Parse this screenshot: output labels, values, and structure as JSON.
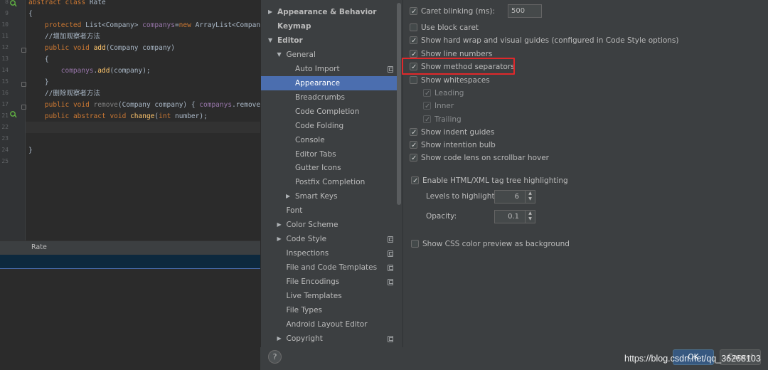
{
  "editor": {
    "lines": [
      {
        "num": "8",
        "code": "abstract class Rate"
      },
      {
        "num": "9",
        "code": "{"
      },
      {
        "num": "10",
        "code": "    protected List<Company> companys=new ArrayList<Company>();"
      },
      {
        "num": "11",
        "code": "    //增加观察者方法"
      },
      {
        "num": "12",
        "code": "    public void add(Company company)"
      },
      {
        "num": "13",
        "code": "    {"
      },
      {
        "num": "14",
        "code": "        companys.add(company);"
      },
      {
        "num": "15",
        "code": "    }"
      },
      {
        "num": "16",
        "code": "    //删除观察者方法"
      },
      {
        "num": "17",
        "code": "    public void remove(Company company) { companys.remove(company); }"
      },
      {
        "num": "21",
        "code": "    public abstract void change(int number);"
      },
      {
        "num": "22",
        "code": ""
      },
      {
        "num": "23",
        "code": ""
      },
      {
        "num": "24",
        "code": "}"
      },
      {
        "num": "25",
        "code": ""
      }
    ],
    "breadcrumb": "Rate"
  },
  "tree": {
    "items": [
      {
        "label": "Appearance & Behavior",
        "bold": true,
        "arrow": "right"
      },
      {
        "label": "Keymap",
        "bold": true
      },
      {
        "label": "Editor",
        "bold": true,
        "arrow": "down"
      },
      {
        "label": "General",
        "arrow": "down"
      },
      {
        "label": "Auto Import",
        "copy": true
      },
      {
        "label": "Appearance",
        "selected": true
      },
      {
        "label": "Breadcrumbs"
      },
      {
        "label": "Code Completion"
      },
      {
        "label": "Code Folding"
      },
      {
        "label": "Console"
      },
      {
        "label": "Editor Tabs"
      },
      {
        "label": "Gutter Icons"
      },
      {
        "label": "Postfix Completion"
      },
      {
        "label": "Smart Keys",
        "arrow": "right"
      },
      {
        "label": "Font"
      },
      {
        "label": "Color Scheme",
        "arrow": "right"
      },
      {
        "label": "Code Style",
        "arrow": "right",
        "copy": true
      },
      {
        "label": "Inspections",
        "copy": true
      },
      {
        "label": "File and Code Templates",
        "copy": true
      },
      {
        "label": "File Encodings",
        "copy": true
      },
      {
        "label": "Live Templates"
      },
      {
        "label": "File Types"
      },
      {
        "label": "Android Layout Editor"
      },
      {
        "label": "Copyright",
        "arrow": "right",
        "copy": true
      }
    ]
  },
  "settings": {
    "caret_blinking_label": "Caret blinking (ms):",
    "caret_blinking_value": "500",
    "block_caret_label": "Use block caret",
    "hard_wrap_label": "Show hard wrap and visual guides (configured in Code Style options)",
    "line_numbers_label": "Show line numbers",
    "method_separators_label": "Show method separators",
    "whitespaces_label": "Show whitespaces",
    "leading_label": "Leading",
    "inner_label": "Inner",
    "trailing_label": "Trailing",
    "indent_guides_label": "Show indent guides",
    "intention_bulb_label": "Show intention bulb",
    "code_lens_label": "Show code lens on scrollbar hover",
    "html_tag_label": "Enable HTML/XML tag tree highlighting",
    "levels_label": "Levels to highlight:",
    "levels_value": "6",
    "opacity_label": "Opacity:",
    "opacity_value": "0.1",
    "css_color_label": "Show CSS color preview as background"
  },
  "footer": {
    "help_label": "?",
    "ok_label": "OK",
    "cancel_label": "Cancel"
  },
  "watermark": "https://blog.csdn.net/qq_36268103",
  "colors": {
    "selection": "#4b6eaf",
    "highlight_box": "#e0282b",
    "ok_button": "#365880"
  }
}
